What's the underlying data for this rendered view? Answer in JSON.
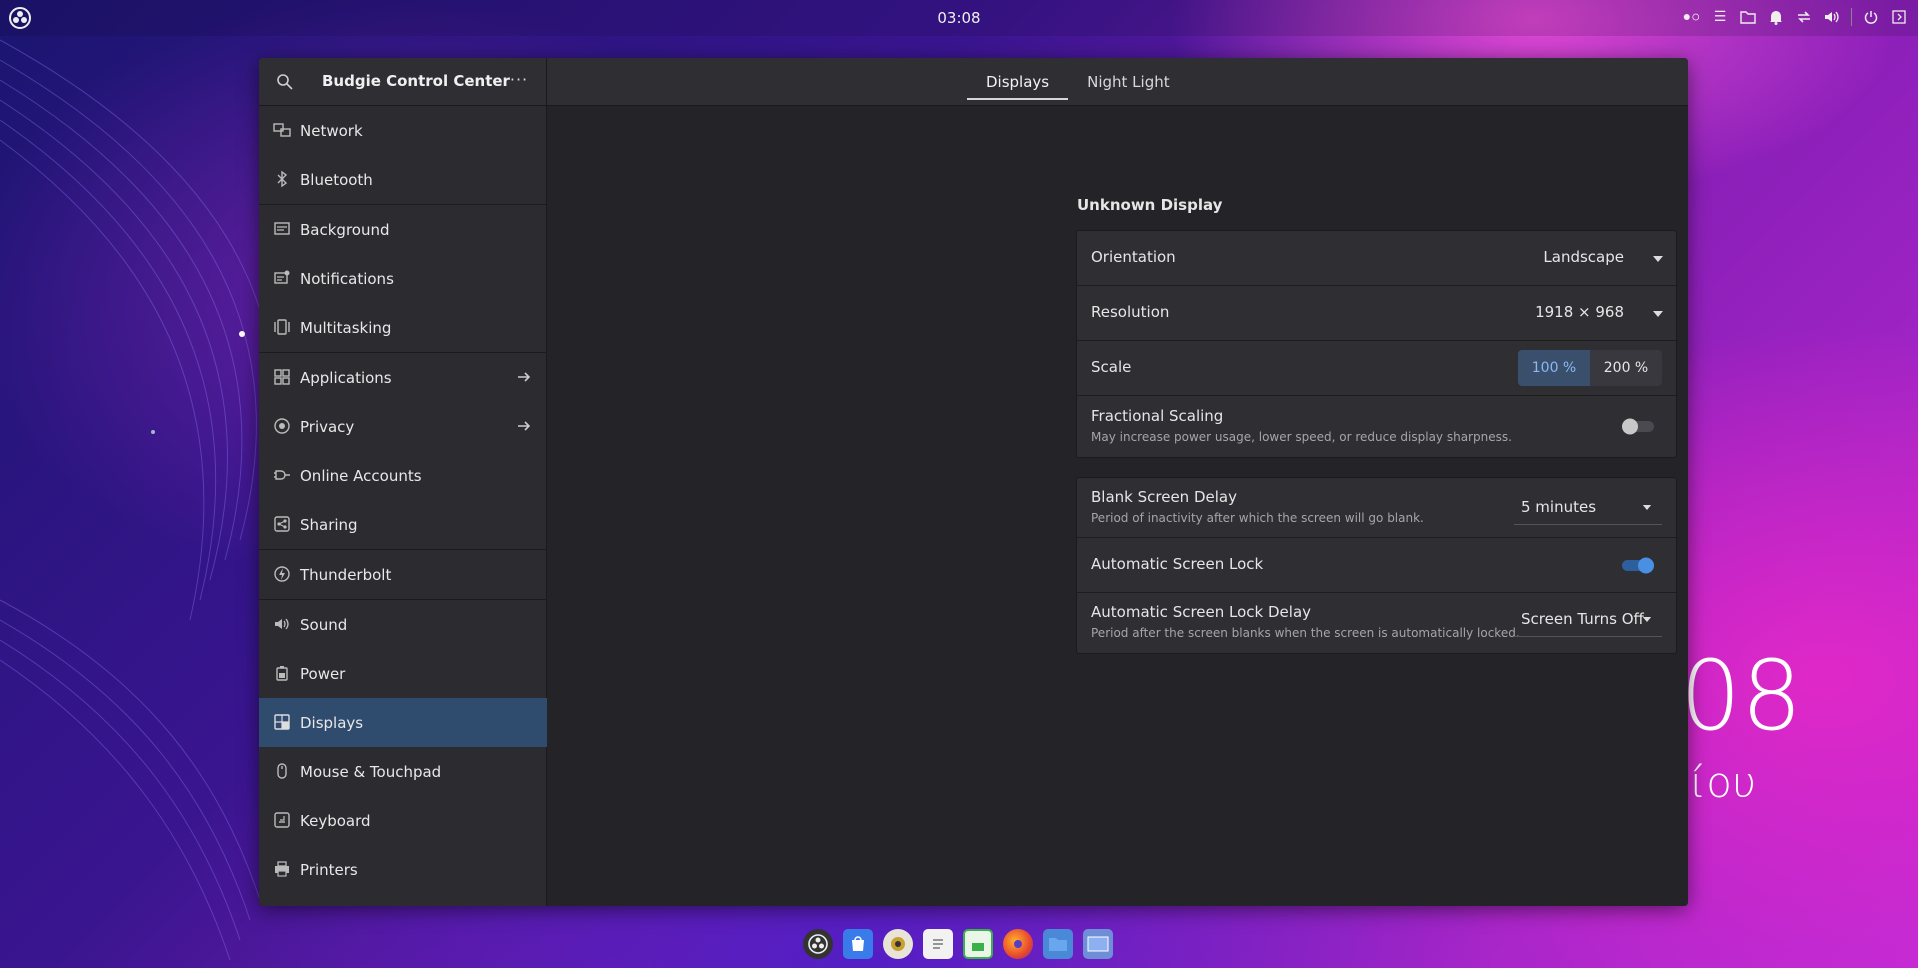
{
  "panel": {
    "clock": "03:08"
  },
  "desktop": {
    "clock_fragment": "08",
    "date_fragment": "ίου"
  },
  "window": {
    "title": "Budgie Control Center",
    "menu_label": "···",
    "tabs": [
      {
        "label": "Displays",
        "active": true
      },
      {
        "label": "Night Light",
        "active": false
      }
    ],
    "controls": {
      "minimize": "–",
      "maximize": "□",
      "close": "✕"
    }
  },
  "sidebar": {
    "items": [
      {
        "label": "Network",
        "icon": "network-icon"
      },
      {
        "label": "Bluetooth",
        "icon": "bluetooth-icon"
      },
      {
        "label": "Background",
        "icon": "background-icon"
      },
      {
        "label": "Notifications",
        "icon": "notifications-icon"
      },
      {
        "label": "Multitasking",
        "icon": "multitasking-icon"
      },
      {
        "label": "Applications",
        "icon": "applications-icon",
        "arrow": true
      },
      {
        "label": "Privacy",
        "icon": "privacy-icon",
        "arrow": true
      },
      {
        "label": "Online Accounts",
        "icon": "online-accounts-icon"
      },
      {
        "label": "Sharing",
        "icon": "sharing-icon"
      },
      {
        "label": "Thunderbolt",
        "icon": "thunderbolt-icon"
      },
      {
        "label": "Sound",
        "icon": "sound-icon"
      },
      {
        "label": "Power",
        "icon": "power-icon"
      },
      {
        "label": "Displays",
        "icon": "displays-icon",
        "active": true
      },
      {
        "label": "Mouse & Touchpad",
        "icon": "mouse-icon"
      },
      {
        "label": "Keyboard",
        "icon": "keyboard-icon"
      },
      {
        "label": "Printers",
        "icon": "printers-icon"
      }
    ]
  },
  "display": {
    "section_title": "Unknown Display",
    "orientation": {
      "label": "Orientation",
      "value": "Landscape"
    },
    "resolution": {
      "label": "Resolution",
      "value": "1918 × 968"
    },
    "scale": {
      "label": "Scale",
      "options": [
        "100 %",
        "200 %"
      ],
      "selected": "100 %"
    },
    "fractional": {
      "label": "Fractional Scaling",
      "subtitle": "May increase power usage, lower speed, or reduce display sharpness.",
      "enabled": false
    }
  },
  "screen": {
    "blank_delay": {
      "label": "Blank Screen Delay",
      "subtitle": "Period of inactivity after which the screen will go blank.",
      "value": "5 minutes"
    },
    "auto_lock": {
      "label": "Automatic Screen Lock",
      "enabled": true
    },
    "lock_delay": {
      "label": "Automatic Screen Lock Delay",
      "subtitle": "Period after the screen blanks when the screen is automatically locked.",
      "value": "Screen Turns Off"
    }
  },
  "colors": {
    "accent": "#3584e4",
    "selected_sidebar": "#2f4b6e",
    "window_bg": "#242428"
  },
  "dock": {
    "icons": [
      "budgie-logo-icon",
      "software-store-icon",
      "rhythmbox-icon",
      "text-editor-icon",
      "spreadsheet-icon",
      "firefox-icon",
      "files-icon",
      "screenshot-icon"
    ]
  }
}
